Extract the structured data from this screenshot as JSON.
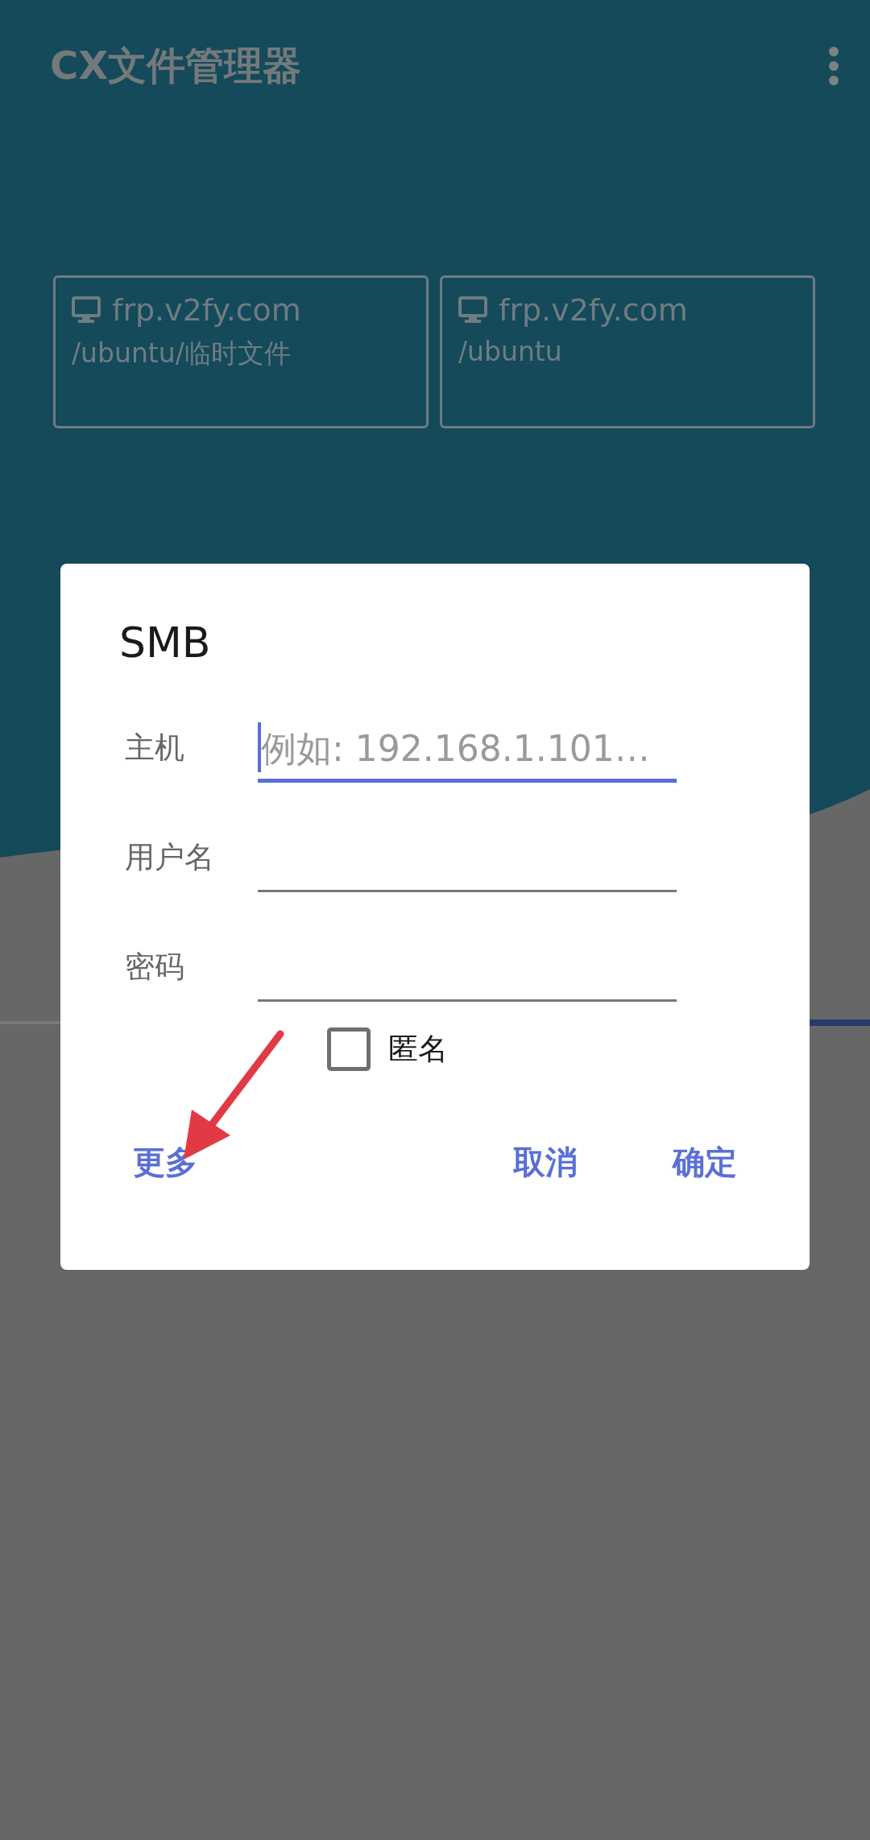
{
  "app_bar": {
    "title": "CX文件管理器"
  },
  "recent_locations": [
    {
      "host": "frp.v2fy.com",
      "path": "/ubuntu/临时文件"
    },
    {
      "host": "frp.v2fy.com",
      "path": "/ubuntu"
    }
  ],
  "dialog": {
    "title": "SMB",
    "fields": [
      {
        "label": "主机",
        "placeholder": "例如: 192.168.1.101…",
        "focused": true
      },
      {
        "label": "用户名",
        "focused": false
      },
      {
        "label": "密码",
        "focused": false
      }
    ],
    "anonymous": {
      "label": "匿名",
      "checked": false
    },
    "buttons": [
      {
        "label": "更多",
        "kind": "left"
      },
      {
        "label": "取消",
        "kind": "right"
      },
      {
        "label": "确定",
        "kind": "right"
      }
    ]
  }
}
